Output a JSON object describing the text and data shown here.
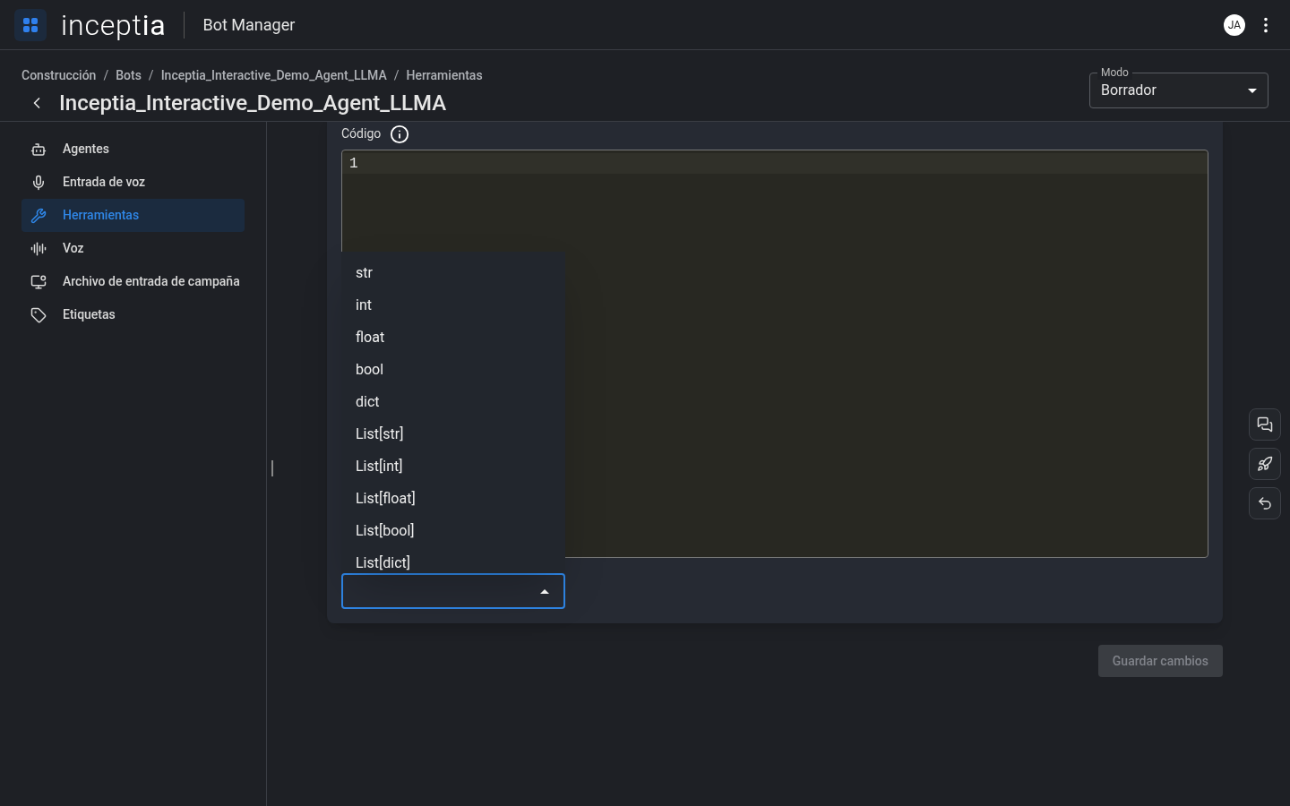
{
  "header": {
    "logo": "incept**ia**",
    "app_name": "Bot Manager",
    "user_initials": "JA"
  },
  "breadcrumbs": [
    {
      "kind": "link",
      "label": "Construcción"
    },
    {
      "kind": "separator",
      "label": "/"
    },
    {
      "kind": "link",
      "label": "Bots"
    },
    {
      "kind": "separator",
      "label": "/"
    },
    {
      "kind": "link",
      "label": "Inceptia_Interactive_Demo_Agent_LLMA"
    },
    {
      "kind": "separator",
      "label": "/"
    },
    {
      "kind": "link",
      "label": "Herramientas"
    }
  ],
  "page_title": "Inceptia_Interactive_Demo_Agent_LLMA",
  "mode_field": {
    "label": "Modo",
    "value": "Borrador"
  },
  "sidebar": {
    "items": [
      {
        "label": "Agentes",
        "selected": false
      },
      {
        "label": "Entrada de voz",
        "selected": false
      },
      {
        "label": "Herramientas",
        "selected": true
      },
      {
        "label": "Voz",
        "selected": false
      },
      {
        "label": "Archivo de entrada de campaña",
        "selected": false
      },
      {
        "label": "Etiquetas",
        "selected": false
      }
    ]
  },
  "code": {
    "label": "Código",
    "line_numbers": [
      "1"
    ]
  },
  "return_type": {
    "expanded": true,
    "options": [
      "str",
      "int",
      "float",
      "bool",
      "dict",
      "List[str]",
      "List[int]",
      "List[float]",
      "List[bool]",
      "List[dict]"
    ]
  },
  "save_button": {
    "label": "Guardar cambios",
    "disabled": true
  }
}
